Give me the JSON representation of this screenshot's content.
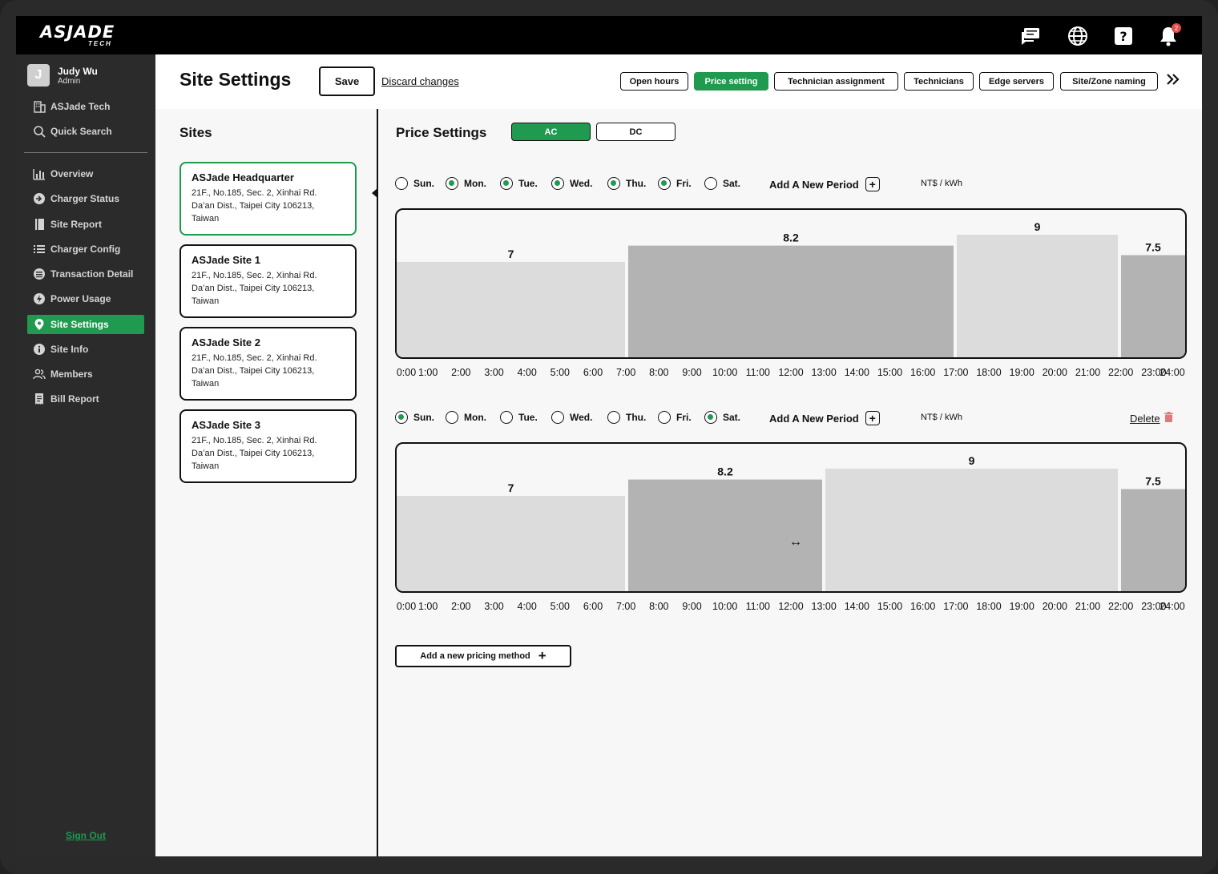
{
  "app": {
    "logo": "ASJADE",
    "logo_sub": "TECH",
    "notification_count": "2",
    "icons": [
      "chat-icon",
      "globe-icon",
      "help-icon",
      "bell-icon"
    ]
  },
  "user": {
    "initial": "J",
    "name": "Judy Wu",
    "role": "Admin"
  },
  "sidebar": {
    "top_items": [
      {
        "label": "ASJade Tech",
        "icon": "building-icon"
      },
      {
        "label": "Quick Search",
        "icon": "search-icon"
      }
    ],
    "items": [
      {
        "label": "Overview",
        "icon": "bar-chart-icon"
      },
      {
        "label": "Charger Status",
        "icon": "plug-icon"
      },
      {
        "label": "Site Report",
        "icon": "book-icon"
      },
      {
        "label": "Charger Config",
        "icon": "list-icon"
      },
      {
        "label": "Transaction Detail",
        "icon": "lines-icon"
      },
      {
        "label": "Power Usage",
        "icon": "bolt-icon"
      },
      {
        "label": "Site Settings",
        "icon": "location-pin-icon",
        "active": true
      },
      {
        "label": "Site Info",
        "icon": "info-icon"
      },
      {
        "label": "Members",
        "icon": "members-icon"
      },
      {
        "label": "Bill Report",
        "icon": "receipt-icon"
      }
    ],
    "sign_out": "Sign Out"
  },
  "header": {
    "title": "Site Settings",
    "save": "Save",
    "discard": "Discard changes",
    "tabs": [
      "Open hours",
      "Price setting",
      "Technician assignment",
      "Technicians",
      "Edge servers",
      "Site/Zone naming"
    ],
    "active_tab": "Price setting"
  },
  "sites": {
    "title": "Sites",
    "items": [
      {
        "name": "ASJade Headquarter",
        "addr1": "21F., No.185, Sec. 2, Xinhai Rd.",
        "addr2": "Da’an Dist., Taipei City 106213,",
        "addr3": "Taiwan"
      },
      {
        "name": "ASJade Site 1",
        "addr1": "21F., No.185, Sec. 2, Xinhai Rd.",
        "addr2": "Da’an Dist., Taipei City 106213,",
        "addr3": "Taiwan"
      },
      {
        "name": "ASJade Site 2",
        "addr1": "21F., No.185, Sec. 2, Xinhai Rd.",
        "addr2": "Da’an Dist., Taipei City 106213,",
        "addr3": "Taiwan"
      },
      {
        "name": "ASJade Site 3",
        "addr1": "21F., No.185, Sec. 2, Xinhai Rd.",
        "addr2": "Da’an Dist., Taipei City 106213,",
        "addr3": "Taiwan"
      }
    ]
  },
  "price": {
    "title": "Price Settings",
    "types": [
      "AC",
      "DC"
    ],
    "active_type": "AC",
    "add_period": "Add A New Period",
    "unit": "NT$ / kWh",
    "delete": "Delete",
    "add_method": "Add a new pricing method",
    "day_labels": [
      "Sun.",
      "Mon.",
      "Tue.",
      "Wed.",
      "Thu.",
      "Fri.",
      "Sat."
    ],
    "hour_labels": [
      "0:00",
      "1:00",
      "2:00",
      "3:00",
      "4:00",
      "5:00",
      "6:00",
      "7:00",
      "8:00",
      "9:00",
      "10:00",
      "11:00",
      "12:00",
      "13:00",
      "14:00",
      "15:00",
      "16:00",
      "17:00",
      "18:00",
      "19:00",
      "20:00",
      "21:00",
      "22:00",
      "23:00",
      "24:00"
    ],
    "methods": [
      {
        "days_selected": [
          false,
          true,
          true,
          true,
          true,
          true,
          false
        ]
      },
      {
        "days_selected": [
          true,
          false,
          false,
          false,
          false,
          false,
          true
        ]
      }
    ]
  },
  "chart_data": [
    {
      "type": "bar",
      "xlabel": "",
      "ylabel": "",
      "x_range": [
        0,
        24
      ],
      "ylim": [
        0,
        10
      ],
      "periods": [
        {
          "start": 0,
          "end": 7,
          "value": 7,
          "color": "#dcdcdc"
        },
        {
          "start": 7,
          "end": 17,
          "value": 8.2,
          "color": "#b3b3b3"
        },
        {
          "start": 17,
          "end": 22,
          "value": 9,
          "color": "#dcdcdc"
        },
        {
          "start": 22,
          "end": 24,
          "value": 7.5,
          "color": "#b3b3b3"
        }
      ]
    },
    {
      "type": "bar",
      "xlabel": "",
      "ylabel": "",
      "x_range": [
        0,
        24
      ],
      "ylim": [
        0,
        10
      ],
      "periods": [
        {
          "start": 0,
          "end": 7,
          "value": 7,
          "color": "#dcdcdc"
        },
        {
          "start": 7,
          "end": 13,
          "value": 8.2,
          "color": "#b3b3b3"
        },
        {
          "start": 13,
          "end": 22,
          "value": 9,
          "color": "#dcdcdc"
        },
        {
          "start": 22,
          "end": 24,
          "value": 7.5,
          "color": "#b3b3b3"
        }
      ]
    }
  ],
  "colors": {
    "accent": "#1f9a4f",
    "topbar": "#000000",
    "sidebar": "#2b2b2b",
    "badge": "#e24c4c"
  }
}
